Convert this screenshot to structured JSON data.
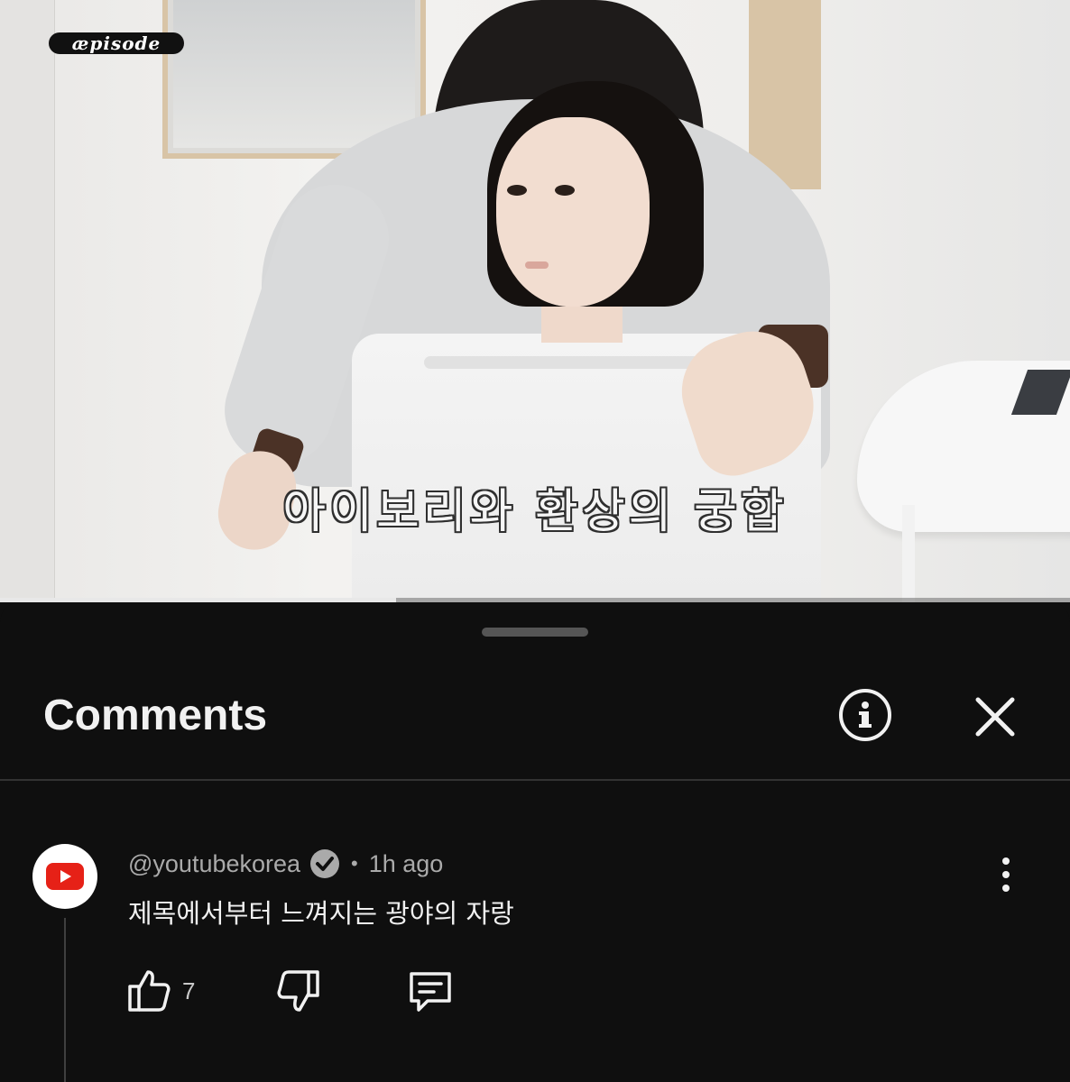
{
  "video": {
    "channel_logo": "æpisode",
    "subtitle": "아이보리와 환상의 궁합",
    "progress": 0.37
  },
  "comments_sheet": {
    "title": "Comments",
    "info_icon": "info-icon",
    "close_icon": "close-icon"
  },
  "comment": {
    "author": "@youtubekorea",
    "verified_icon": "verified-check-icon",
    "separator": "•",
    "time": "1h ago",
    "text": "제목에서부터 느껴지는 광야의 자랑",
    "avatar_icon": "youtube-logo-icon",
    "like_count": "7",
    "like_icon": "thumbs-up-icon",
    "dislike_icon": "thumbs-down-icon",
    "reply_icon": "reply-comment-icon",
    "more_icon": "more-vertical-icon"
  },
  "colors": {
    "sheet_background": "#0f0f0f",
    "youtube_red": "#ff0000",
    "secondary_text": "#aaaaaa",
    "primary_text": "#f1f1f1"
  }
}
